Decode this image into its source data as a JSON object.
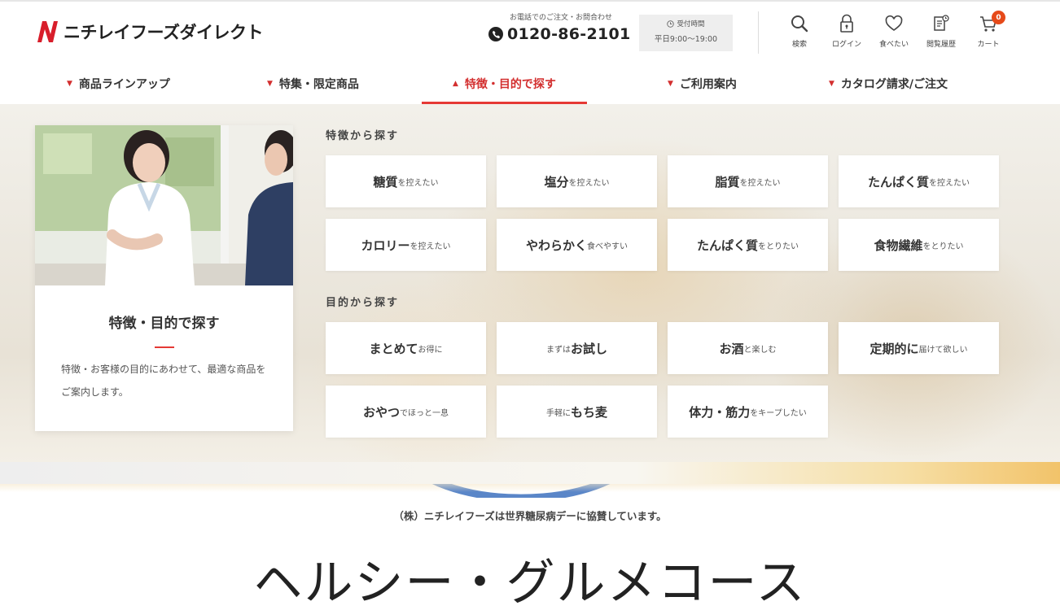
{
  "header": {
    "logo_text": "ニチレイフーズダイレクト",
    "phone_caption": "お電話でのご注文・お問合わせ",
    "phone_number": "0120-86-2101",
    "hours_label": "受付時間",
    "hours_value": "平日9:00〜19:00",
    "utility": [
      {
        "label": "検索",
        "icon": "search-icon"
      },
      {
        "label": "ログイン",
        "icon": "lock-icon"
      },
      {
        "label": "食べたい",
        "icon": "heart-icon"
      },
      {
        "label": "閲覧履歴",
        "icon": "history-icon"
      },
      {
        "label": "カート",
        "icon": "cart-icon"
      }
    ],
    "cart_count": "0",
    "accent_color": "#e53935"
  },
  "nav": {
    "items": [
      {
        "label": "商品ラインアップ"
      },
      {
        "label": "特集・限定商品"
      },
      {
        "label": "特徴・目的で探す"
      },
      {
        "label": "ご利用案内"
      },
      {
        "label": "カタログ請求/ご注文"
      }
    ],
    "active": "特徴・目的で探す"
  },
  "mega": {
    "card_title": "特徴・目的で探す",
    "card_desc": "特徴・お客様の目的にあわせて、最適な商品をご案内します。",
    "features_heading": "特徴から探す",
    "purposes_heading": "目的から探す",
    "features": [
      {
        "pre": "",
        "main": "糖質",
        "post": "を控えたい"
      },
      {
        "pre": "",
        "main": "塩分",
        "post": "を控えたい"
      },
      {
        "pre": "",
        "main": "脂質",
        "post": "を控えたい"
      },
      {
        "pre": "",
        "main": "たんぱく質",
        "post": "を控えたい"
      },
      {
        "pre": "",
        "main": "カロリー",
        "post": "を控えたい"
      },
      {
        "pre": "",
        "main": "やわらかく",
        "post": "食べやすい"
      },
      {
        "pre": "",
        "main": "たんぱく質",
        "post": "をとりたい"
      },
      {
        "pre": "",
        "main": "食物繊維",
        "post": "をとりたい"
      }
    ],
    "purposes": [
      {
        "pre": "",
        "main": "まとめて",
        "post": "お得に"
      },
      {
        "pre": "まずは",
        "main": "お試し",
        "post": ""
      },
      {
        "pre": "",
        "main": "お酒",
        "post": "と楽しむ"
      },
      {
        "pre": "",
        "main": "定期的に",
        "post": "届けて欲しい"
      },
      {
        "pre": "",
        "main": "おやつ",
        "post": "でほっと一息"
      },
      {
        "pre": "手軽に",
        "main": "もち麦",
        "post": ""
      },
      {
        "pre": "",
        "main": "体力・筋力",
        "post": "をキープしたい"
      }
    ]
  },
  "content": {
    "sponsor_note": "（株）ニチレイフーズは世界糖尿病デーに協賛しています。",
    "hero_title": "ヘルシー・グルメコース",
    "arc_color": "#5a86c8"
  }
}
